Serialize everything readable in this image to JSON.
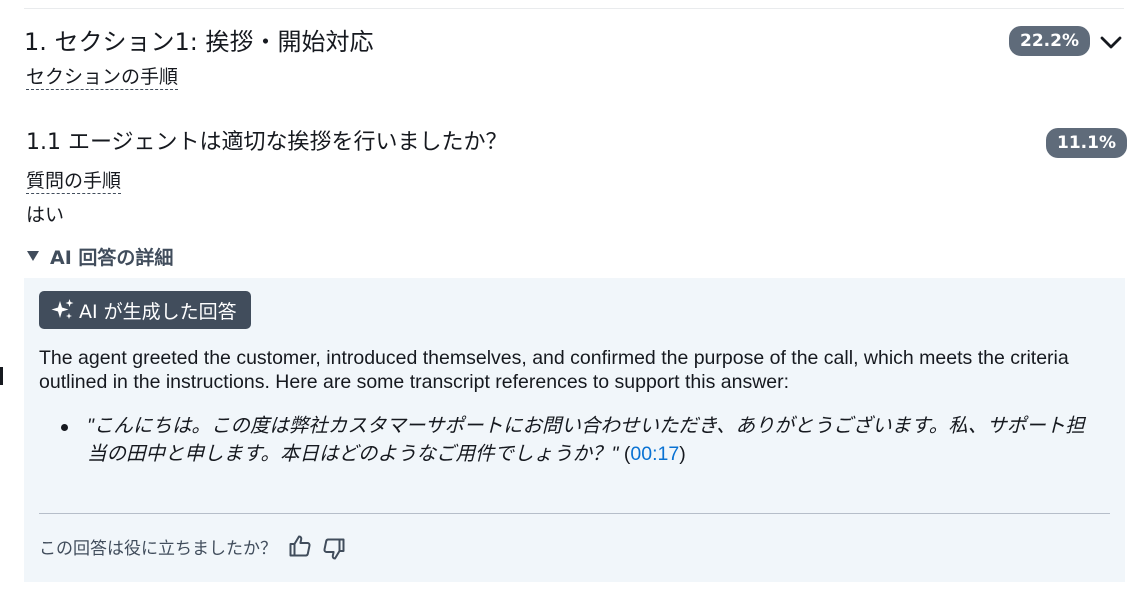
{
  "section": {
    "title": "1. セクション1: 挨拶・開始対応",
    "steps_link": "セクションの手順",
    "score": "22.2%"
  },
  "question": {
    "title": "1.1 エージェントは適切な挨拶を行いましたか？",
    "steps_link": "質問の手順",
    "answer": "はい",
    "score": "11.1%"
  },
  "details": {
    "toggle_label": "AI 回答の詳細",
    "ai_badge_label": "AI が生成した回答",
    "explanation": "The agent greeted the customer, introduced themselves, and confirmed the purpose of the call, which meets the criteria outlined in the instructions. Here are some transcript references to support this answer:",
    "references": [
      {
        "quote": "\"こんにちは。この度は弊社カスタマーサポートにお問い合わせいただき、ありがとうございます。私、サポート担当の田中と申します。本日はどのようなご用件でしょうか？\"",
        "open_paren": " (",
        "timestamp": "00:17",
        "close_paren": ")"
      }
    ],
    "feedback_prompt": "この回答は役に立ちましたか？"
  },
  "colors": {
    "badge_bg": "#5f6b7a",
    "ai_badge_bg": "#414d5c",
    "panel_bg": "#f1f6fa",
    "link": "#0972d3"
  },
  "icons": [
    "chevron-down-icon",
    "caret-down-icon",
    "sparkle-icon",
    "thumbs-up-icon",
    "thumbs-down-icon"
  ]
}
